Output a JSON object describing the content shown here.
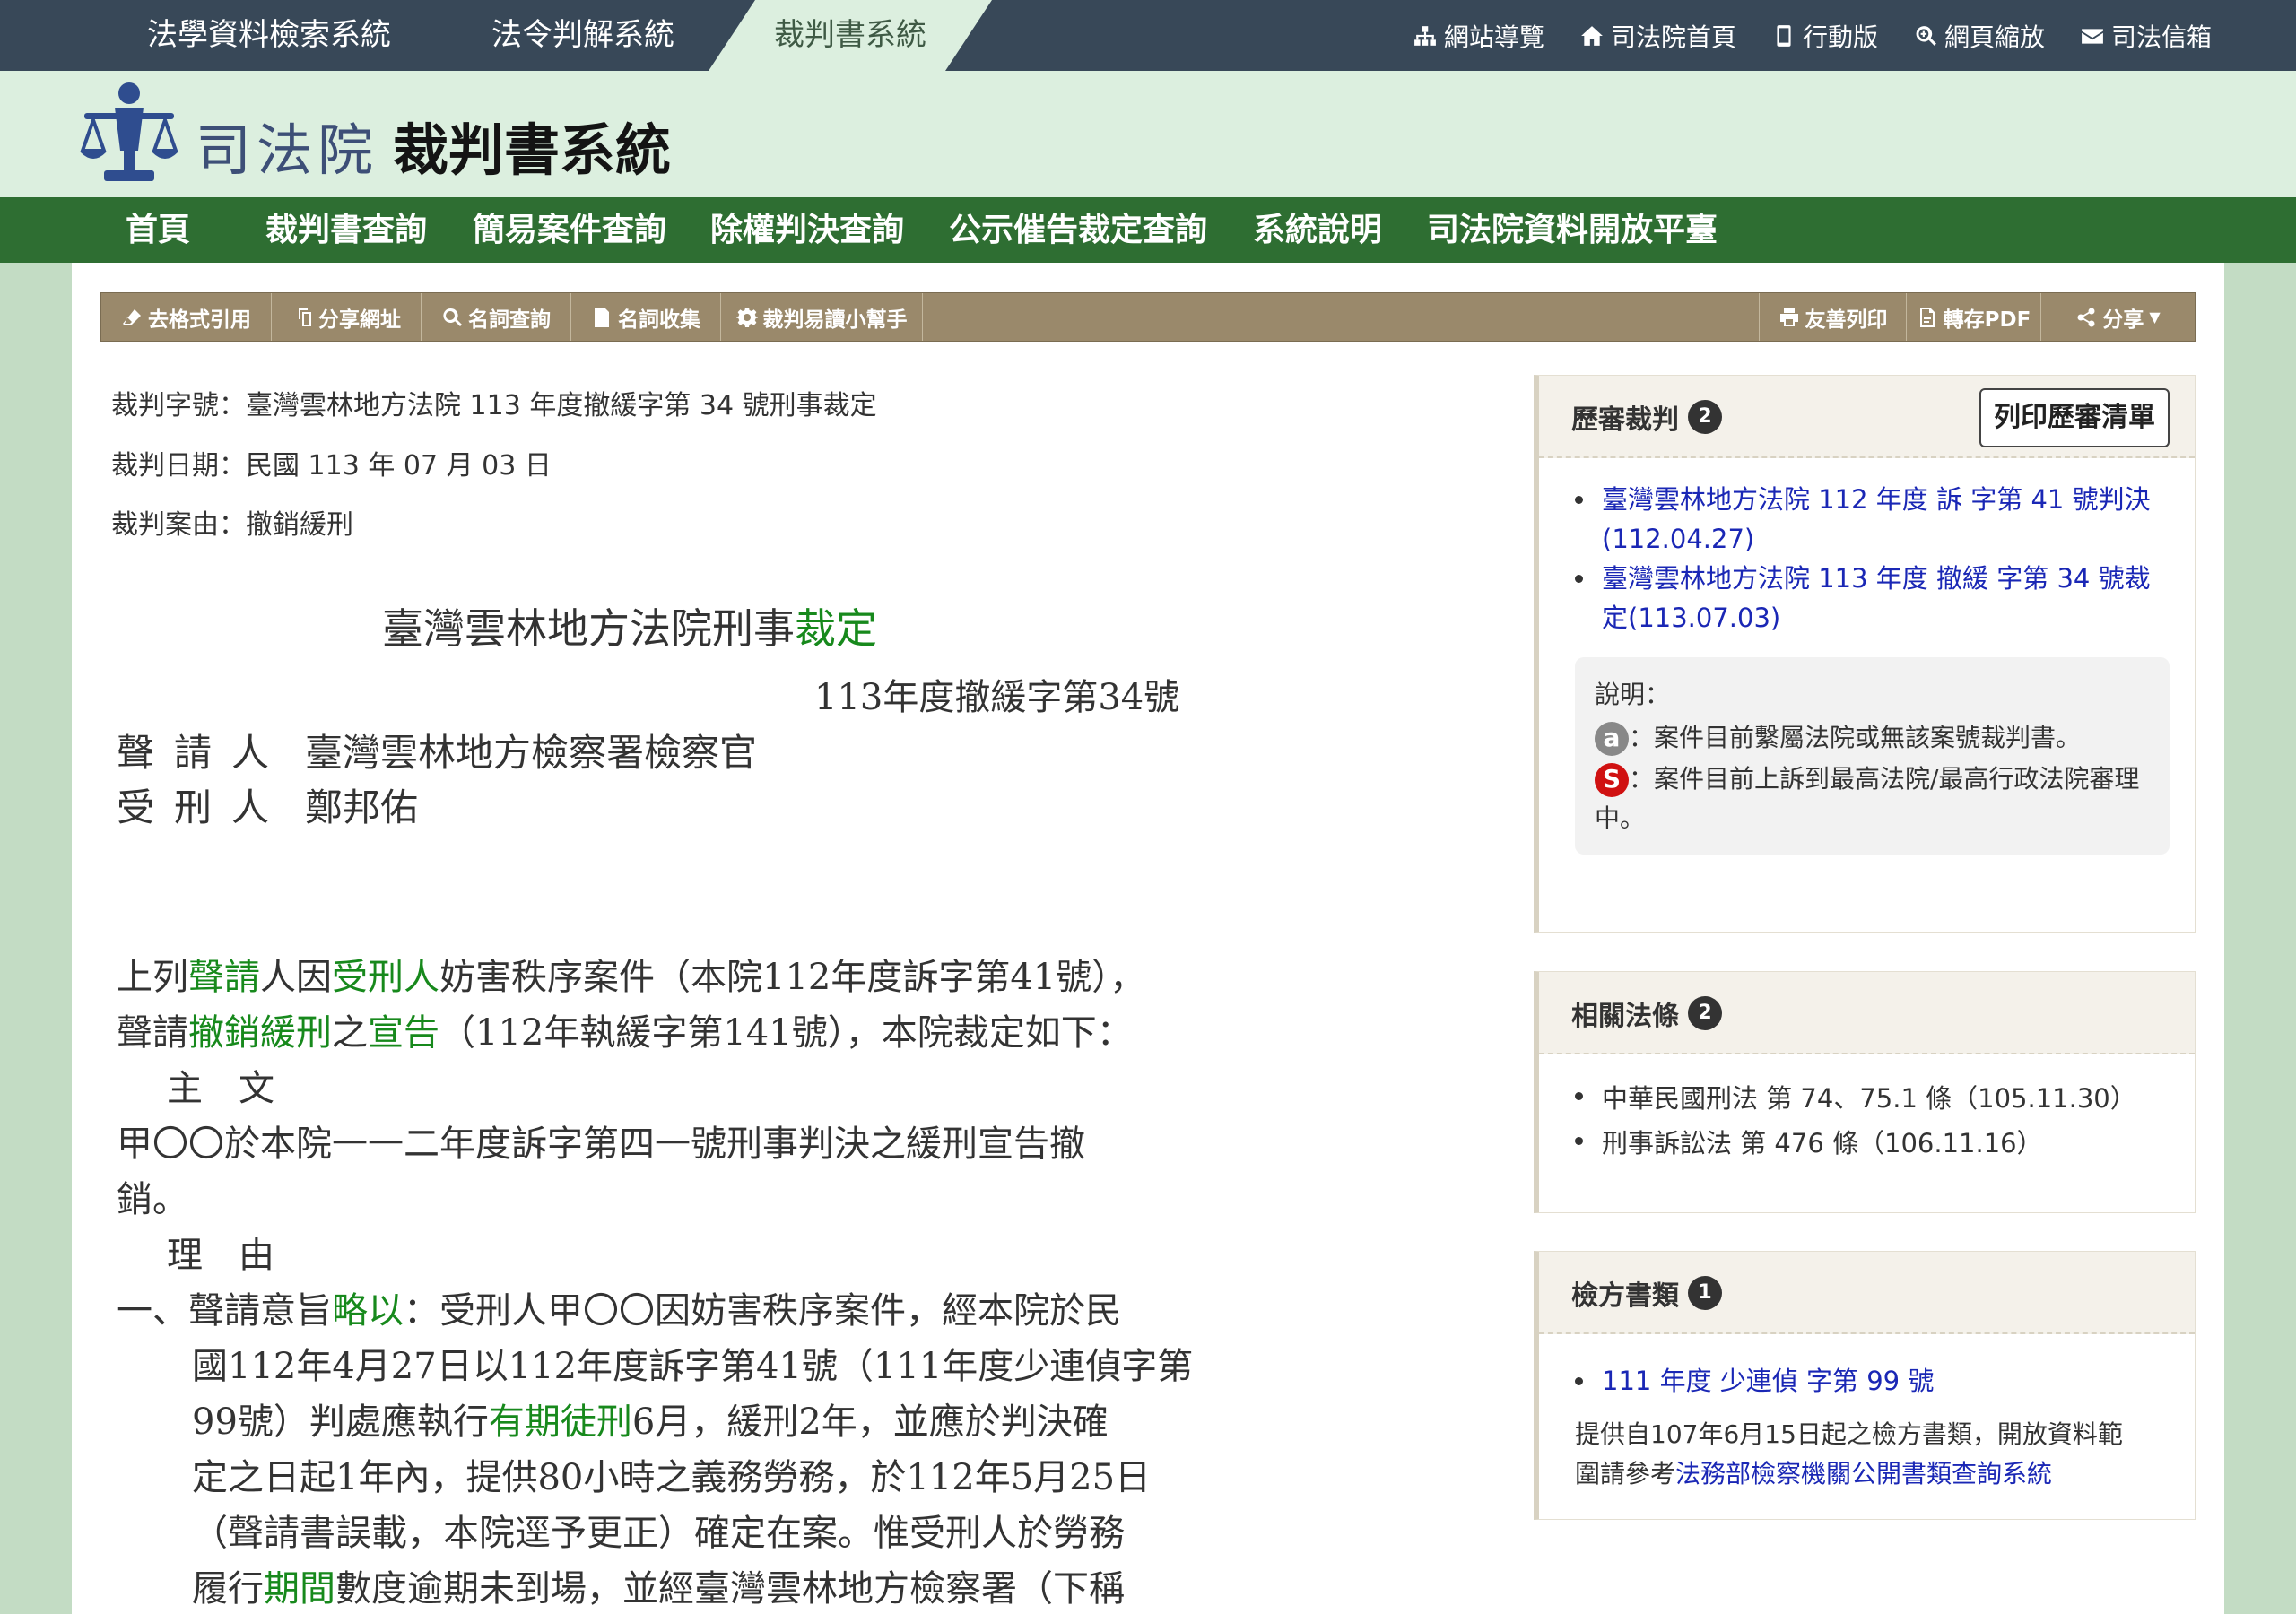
{
  "top_tabs": [
    "法學資料檢索系統",
    "法令判解系統",
    "裁判書系統"
  ],
  "top_links": [
    {
      "label": "網站導覽",
      "icon": "sitemap-icon"
    },
    {
      "label": "司法院首頁",
      "icon": "home-icon"
    },
    {
      "label": "行動版",
      "icon": "mobile-icon"
    },
    {
      "label": "網頁縮放",
      "icon": "zoom-icon"
    },
    {
      "label": "司法信箱",
      "icon": "mail-icon"
    }
  ],
  "header": {
    "org": "司法院",
    "system": "裁判書系統"
  },
  "nav": [
    "首頁",
    "裁判書查詢",
    "簡易案件查詢",
    "除權判決查詢",
    "公示催告裁定查詢",
    "系統說明",
    "司法院資料開放平臺"
  ],
  "toolbar": {
    "left": [
      {
        "label": "去格式引用",
        "icon": "eraser-icon"
      },
      {
        "label": "分享網址",
        "icon": "copy-link-icon"
      },
      {
        "label": "名詞查詢",
        "icon": "search-icon"
      },
      {
        "label": "名詞收集",
        "icon": "document-icon"
      },
      {
        "label": "裁判易讀小幫手",
        "icon": "gear-icon"
      }
    ],
    "right": [
      {
        "label": "友善列印",
        "icon": "print-icon"
      },
      {
        "label": "轉存PDF",
        "icon": "pdf-icon"
      },
      {
        "label": "分享",
        "icon": "share-icon"
      }
    ]
  },
  "meta": {
    "case_no": "裁判字號：臺灣雲林地方法院 113 年度撤緩字第 34 號刑事裁定",
    "date": "裁判日期：民國 113 年 07 月 03 日",
    "reason": "裁判案由：撤銷緩刑"
  },
  "document": {
    "title_prefix": "臺灣雲林地方法院刑事",
    "title_kw": "裁定",
    "case_number": "113年度撤緩字第34號",
    "parties": [
      {
        "role": "聲請人",
        "name": "臺灣雲林地方檢察署檢察官"
      },
      {
        "role": "受刑人",
        "name": "鄭邦佑"
      }
    ],
    "lines": {
      "l1_a": "上列",
      "l1_b": "聲請",
      "l1_c": "人因",
      "l1_d": "受刑人",
      "l1_e": "妨害秩序案件（本院112年度訴字第41號），",
      "l2_a": "聲請",
      "l2_b": "撤銷緩刑",
      "l2_c": "之",
      "l2_d": "宣告",
      "l2_e": "（112年執緩字第141號），本院裁定如下：",
      "l3": "主　文",
      "l4": "甲〇〇於本院一一二年度訴字第四一號刑事判決之緩刑宣告撤",
      "l5": "銷。",
      "l6": "理　由",
      "l7_a": "一、聲請意旨",
      "l7_b": "略以",
      "l7_c": "：受刑人甲〇〇因妨害秩序案件，經本院於民",
      "l8": "國112年4月27日以112年度訴字第41號（111年度少連偵字第",
      "l9_a": "99號）判處應執行",
      "l9_b": "有期徒刑",
      "l9_c": "6月，緩刑2年，並應於判決確",
      "l10": "定之日起1年內，提供80小時之義務勞務，於112年5月25日",
      "l11": "（聲請書誤載，本院逕予更正）確定在案。惟受刑人於勞務",
      "l12_a": "履行",
      "l12_b": "期間",
      "l12_c": "數度逾期未到場，並經臺灣雲林地方檢察署（下稱"
    }
  },
  "sidebar": {
    "history": {
      "title": "歷審裁判",
      "count": "2",
      "print_label": "列印歷審清單",
      "items": [
        "臺灣雲林地方法院 112 年度 訴 字第 41 號判決(112.04.27)",
        "臺灣雲林地方法院 113 年度 撤緩 字第 34 號裁定(113.07.03)"
      ],
      "note_title": "說明：",
      "note_a_icon": "a",
      "note_a": "：案件目前繫屬法院或無該案號裁判書。",
      "note_s_icon": "S",
      "note_s": "：案件目前上訴到最高法院/最高行政法院審理中。"
    },
    "laws": {
      "title": "相關法條",
      "count": "2",
      "items": [
        "中華民國刑法 第 74、75.1 條（105.11.30）",
        "刑事訴訟法 第 476 條（106.11.16）"
      ]
    },
    "prosecutor": {
      "title": "檢方書類",
      "count": "1",
      "items": [
        "111 年度 少連偵 字第 99 號"
      ],
      "info_text": "提供自107年6月15日起之檢方書類，開放資料範圍請參考",
      "info_link": "法務部檢察機關公開書類查詢系統"
    }
  },
  "colors": {
    "topbar": "#384858",
    "banner": "#dcefdf",
    "nav": "#2e6e32",
    "toolbar": "#9a896b",
    "keyword": "#17891c",
    "link": "#1a27b5"
  }
}
